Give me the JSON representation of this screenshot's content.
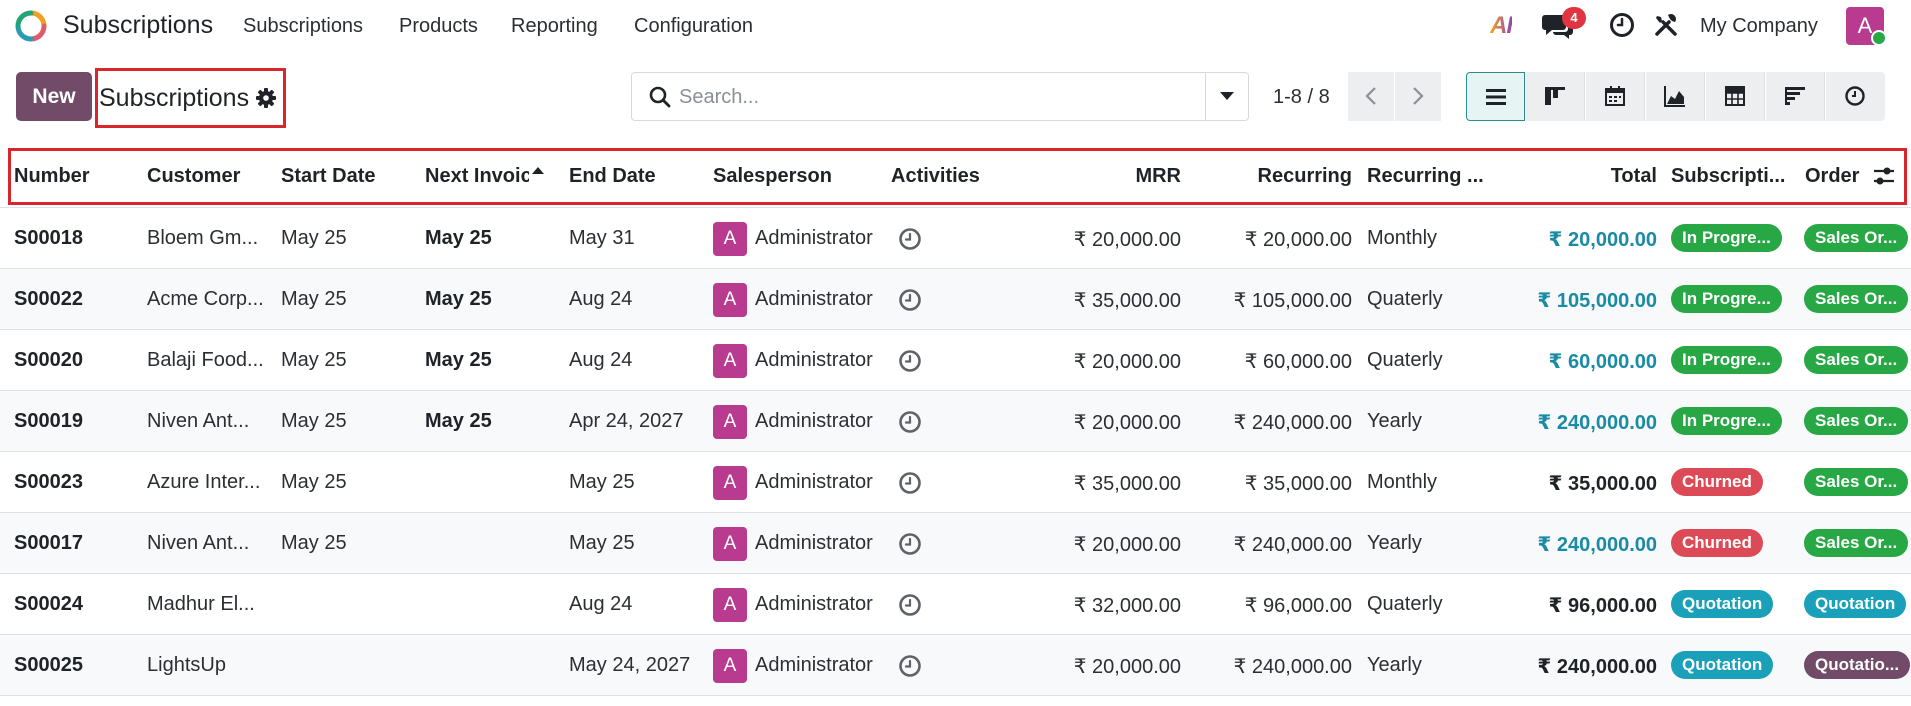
{
  "app": {
    "name": "Subscriptions",
    "menu": [
      "Subscriptions",
      "Products",
      "Reporting",
      "Configuration"
    ],
    "ai_label": "AI",
    "message_count": "4",
    "company": "My Company",
    "user_initial": "A"
  },
  "control": {
    "new_label": "New",
    "breadcrumb": "Subscriptions",
    "search_placeholder": "Search...",
    "pager": "1-8 / 8"
  },
  "columns": {
    "number": "Number",
    "customer": "Customer",
    "start_date": "Start Date",
    "next_invoice": "Next Invoice",
    "end_date": "End Date",
    "salesperson": "Salesperson",
    "activities": "Activities",
    "mrr": "MRR",
    "recurring": "Recurring",
    "recurring_plan": "Recurring ...",
    "total": "Total",
    "subscription_status": "Subscripti...",
    "order": "Order"
  },
  "rows": [
    {
      "number": "S00018",
      "customer": "Bloem Gm...",
      "start": "May 25",
      "next": "May 25",
      "end": "May 31",
      "sp_initial": "A",
      "salesperson": "Administrator",
      "mrr": "₹ 20,000.00",
      "recurring": "₹ 20,000.00",
      "plan": "Monthly",
      "total": "₹ 20,000.00",
      "status": "In Progre...",
      "order": "Sales Or..."
    },
    {
      "number": "S00022",
      "customer": "Acme Corp...",
      "start": "May 25",
      "next": "May 25",
      "end": "Aug 24",
      "sp_initial": "A",
      "salesperson": "Administrator",
      "mrr": "₹ 35,000.00",
      "recurring": "₹ 105,000.00",
      "plan": "Quaterly",
      "total": "₹ 105,000.00",
      "status": "In Progre...",
      "order": "Sales Or..."
    },
    {
      "number": "S00020",
      "customer": "Balaji Food...",
      "start": "May 25",
      "next": "May 25",
      "end": "Aug 24",
      "sp_initial": "A",
      "salesperson": "Administrator",
      "mrr": "₹ 20,000.00",
      "recurring": "₹ 60,000.00",
      "plan": "Quaterly",
      "total": "₹ 60,000.00",
      "status": "In Progre...",
      "order": "Sales Or..."
    },
    {
      "number": "S00019",
      "customer": "Niven Ant...",
      "start": "May 25",
      "next": "May 25",
      "end": "Apr 24, 2027",
      "sp_initial": "A",
      "salesperson": "Administrator",
      "mrr": "₹ 20,000.00",
      "recurring": "₹ 240,000.00",
      "plan": "Yearly",
      "total": "₹ 240,000.00",
      "status": "In Progre...",
      "order": "Sales Or..."
    },
    {
      "number": "S00023",
      "customer": "Azure Inter...",
      "start": "May 25",
      "next": "",
      "end": "May 25",
      "sp_initial": "A",
      "salesperson": "Administrator",
      "mrr": "₹ 35,000.00",
      "recurring": "₹ 35,000.00",
      "plan": "Monthly",
      "total": "₹ 35,000.00",
      "status": "Churned",
      "order": "Sales Or..."
    },
    {
      "number": "S00017",
      "customer": "Niven Ant...",
      "start": "May 25",
      "next": "",
      "end": "May 25",
      "sp_initial": "A",
      "salesperson": "Administrator",
      "mrr": "₹ 20,000.00",
      "recurring": "₹ 240,000.00",
      "plan": "Yearly",
      "total": "₹ 240,000.00",
      "status": "Churned",
      "order": "Sales Or..."
    },
    {
      "number": "S00024",
      "customer": "Madhur El...",
      "start": "",
      "next": "",
      "end": "Aug 24",
      "sp_initial": "A",
      "salesperson": "Administrator",
      "mrr": "₹ 32,000.00",
      "recurring": "₹ 96,000.00",
      "plan": "Quaterly",
      "total": "₹ 96,000.00",
      "status": "Quotation",
      "order": "Quotation"
    },
    {
      "number": "S00025",
      "customer": "LightsUp",
      "start": "",
      "next": "",
      "end": "May 24, 2027",
      "sp_initial": "A",
      "salesperson": "Administrator",
      "mrr": "₹ 20,000.00",
      "recurring": "₹ 240,000.00",
      "plan": "Yearly",
      "total": "₹ 240,000.00",
      "status": "Quotation",
      "order": "Quotatio..."
    }
  ],
  "colors": {
    "brand": "#714b67",
    "total_teal": "#1a8ba4",
    "status_green": "#28a745",
    "status_red": "#dc4a57",
    "status_teal": "#1aa0b8"
  }
}
